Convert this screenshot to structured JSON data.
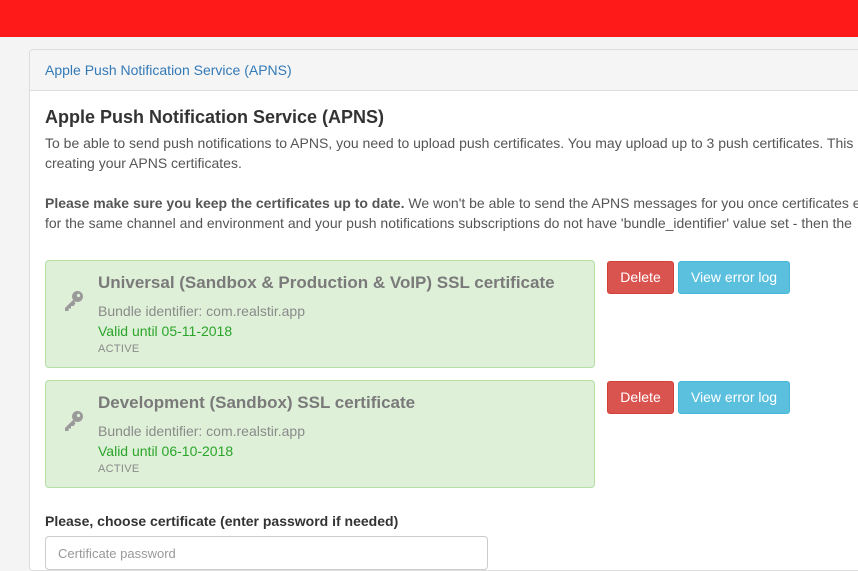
{
  "colors": {
    "topbar": "#ff1a1a",
    "link": "#337ab7",
    "success_bg": "#dff0d8",
    "success_text": "#2aa52a",
    "danger": "#d9534f",
    "info": "#5bc0de"
  },
  "panel": {
    "heading": "Apple Push Notification Service (APNS)"
  },
  "content": {
    "title": "Apple Push Notification Service (APNS)",
    "intro_line1": "To be able to send push notifications to APNS, you need to upload push certificates. You may upload up to 3 push certificates. This",
    "intro_line2": "creating your APNS certificates.",
    "warning_bold": "Please make sure you keep the certificates up to date.",
    "warning_line1_rest": " We won't be able to send the APNS messages for you once certificates e",
    "warning_line2": "for the same channel and environment and your push notifications subscriptions do not have 'bundle_identifier' value set - then the"
  },
  "certificates": [
    {
      "icon": "key-icon",
      "title": "Universal (Sandbox & Production & VoIP) SSL certificate",
      "bundle": "Bundle identifier: com.realstir.app",
      "valid": "Valid until 05-11-2018",
      "status": "ACTIVE",
      "delete_label": "Delete",
      "log_label": "View error log"
    },
    {
      "icon": "key-icon",
      "title": "Development (Sandbox) SSL certificate",
      "bundle": "Bundle identifier: com.realstir.app",
      "valid": "Valid until 06-10-2018",
      "status": "ACTIVE",
      "delete_label": "Delete",
      "log_label": "View error log"
    }
  ],
  "upload": {
    "label": "Please, choose certificate (enter password if needed)",
    "password_placeholder": "Certificate password"
  }
}
